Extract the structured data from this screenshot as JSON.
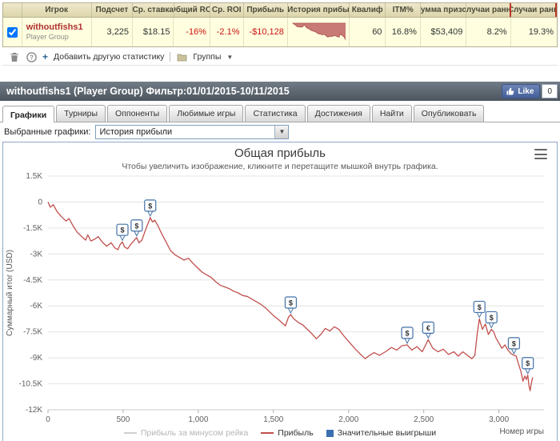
{
  "table": {
    "headers": [
      "Игрок",
      "Подсчет",
      "Ср. ставка",
      "Общий ROI",
      "Ср. ROI",
      "Прибыль",
      "История прибы",
      "Квалиф",
      "ITM%",
      "Сумма призов",
      "Случаи ранне",
      "Случаи ранн"
    ],
    "row": {
      "player": "withoutfishs1",
      "player_sub": "Player Group",
      "count": "3,225",
      "avg_stake": "$18.15",
      "total_roi": "-16%",
      "avg_roi": "-2.1%",
      "profit": "-$10,128",
      "qualif": "60",
      "itm": "16.8%",
      "prizes": "$53,409",
      "early1": "8.2%",
      "early2": "19.3%"
    }
  },
  "toolbar": {
    "add_stat": "Добавить другую статистику",
    "groups": "Группы"
  },
  "header_bar": {
    "title": "withoutfishs1 (Player Group) Фильтр:01/01/2015-10/11/2015",
    "fb_like": "Like",
    "fb_count": "0"
  },
  "tabs": [
    {
      "label": "Графики"
    },
    {
      "label": "Турниры"
    },
    {
      "label": "Оппоненты"
    },
    {
      "label": "Любимые игры"
    },
    {
      "label": "Статистика"
    },
    {
      "label": "Достижения"
    },
    {
      "label": "Найти"
    },
    {
      "label": "Опубликовать"
    }
  ],
  "graph_select": {
    "label": "Выбранные графики:",
    "value": "История прибыли"
  },
  "chart_data": {
    "type": "line",
    "title": "Общая прибыль",
    "subtitle": "Чтобы увеличить изображение, кликните и перетащите мышкой внутрь графика.",
    "xlabel": "Номер игры",
    "ylabel": "Суммарный итог (USD)",
    "xlim": [
      0,
      3300
    ],
    "ylim": [
      -12000,
      1500
    ],
    "yticks": [
      1500,
      0,
      -1500,
      -3000,
      -4500,
      -6000,
      -7500,
      -9000,
      -10500,
      -12000
    ],
    "ytick_labels": [
      "1.5K",
      "0",
      "-1.5K",
      "-3K",
      "-4.5K",
      "-6K",
      "-7.5K",
      "-9K",
      "-10.5K",
      "-12K"
    ],
    "xticks": [
      0,
      500,
      1000,
      1500,
      2000,
      2500,
      3000
    ],
    "xtick_labels": [
      "0",
      "500",
      "1,000",
      "1,500",
      "2,000",
      "2,500",
      "3,000"
    ],
    "grid": true,
    "legend_position": "bottom",
    "series": [
      {
        "name": "Прибыль",
        "color": "#c0504d",
        "points": [
          [
            0,
            0
          ],
          [
            15,
            -300
          ],
          [
            35,
            -150
          ],
          [
            60,
            -550
          ],
          [
            90,
            -850
          ],
          [
            120,
            -1100
          ],
          [
            140,
            -950
          ],
          [
            165,
            -1350
          ],
          [
            195,
            -1750
          ],
          [
            225,
            -2000
          ],
          [
            250,
            -2200
          ],
          [
            265,
            -1900
          ],
          [
            285,
            -2250
          ],
          [
            310,
            -2150
          ],
          [
            335,
            -2000
          ],
          [
            360,
            -2300
          ],
          [
            390,
            -2550
          ],
          [
            420,
            -2350
          ],
          [
            445,
            -2650
          ],
          [
            465,
            -2750
          ],
          [
            480,
            -2450
          ],
          [
            495,
            -2300
          ],
          [
            510,
            -2600
          ],
          [
            530,
            -2700
          ],
          [
            550,
            -2450
          ],
          [
            570,
            -2250
          ],
          [
            590,
            -2050
          ],
          [
            605,
            -2350
          ],
          [
            625,
            -2200
          ],
          [
            645,
            -1700
          ],
          [
            665,
            -1250
          ],
          [
            680,
            -900
          ],
          [
            695,
            -1150
          ],
          [
            710,
            -1050
          ],
          [
            730,
            -1350
          ],
          [
            755,
            -1800
          ],
          [
            785,
            -2300
          ],
          [
            815,
            -2800
          ],
          [
            845,
            -3050
          ],
          [
            875,
            -3200
          ],
          [
            905,
            -3350
          ],
          [
            935,
            -3250
          ],
          [
            965,
            -3550
          ],
          [
            995,
            -3800
          ],
          [
            1025,
            -4050
          ],
          [
            1055,
            -4200
          ],
          [
            1085,
            -4350
          ],
          [
            1115,
            -4600
          ],
          [
            1145,
            -4800
          ],
          [
            1175,
            -4900
          ],
          [
            1205,
            -5000
          ],
          [
            1235,
            -5150
          ],
          [
            1265,
            -5250
          ],
          [
            1295,
            -5400
          ],
          [
            1325,
            -5450
          ],
          [
            1355,
            -5600
          ],
          [
            1385,
            -5750
          ],
          [
            1415,
            -5900
          ],
          [
            1445,
            -6100
          ],
          [
            1475,
            -6350
          ],
          [
            1505,
            -6600
          ],
          [
            1535,
            -6800
          ],
          [
            1560,
            -7000
          ],
          [
            1580,
            -7150
          ],
          [
            1600,
            -6650
          ],
          [
            1615,
            -6500
          ],
          [
            1635,
            -6750
          ],
          [
            1665,
            -6950
          ],
          [
            1695,
            -7100
          ],
          [
            1725,
            -7350
          ],
          [
            1755,
            -7600
          ],
          [
            1785,
            -7900
          ],
          [
            1815,
            -7650
          ],
          [
            1845,
            -7300
          ],
          [
            1875,
            -7450
          ],
          [
            1905,
            -7200
          ],
          [
            1935,
            -7350
          ],
          [
            1965,
            -7700
          ],
          [
            2000,
            -8050
          ],
          [
            2040,
            -8450
          ],
          [
            2080,
            -8800
          ],
          [
            2110,
            -9050
          ],
          [
            2140,
            -8850
          ],
          [
            2170,
            -8700
          ],
          [
            2205,
            -8850
          ],
          [
            2245,
            -8650
          ],
          [
            2285,
            -8400
          ],
          [
            2320,
            -8550
          ],
          [
            2355,
            -8300
          ],
          [
            2390,
            -8250
          ],
          [
            2420,
            -8550
          ],
          [
            2455,
            -8350
          ],
          [
            2490,
            -8650
          ],
          [
            2530,
            -7950
          ],
          [
            2560,
            -8450
          ],
          [
            2595,
            -8650
          ],
          [
            2630,
            -8500
          ],
          [
            2665,
            -8800
          ],
          [
            2700,
            -8650
          ],
          [
            2730,
            -8900
          ],
          [
            2760,
            -8650
          ],
          [
            2790,
            -8850
          ],
          [
            2820,
            -9050
          ],
          [
            2840,
            -8850
          ],
          [
            2855,
            -7650
          ],
          [
            2870,
            -6750
          ],
          [
            2890,
            -7350
          ],
          [
            2910,
            -7050
          ],
          [
            2930,
            -7650
          ],
          [
            2950,
            -7350
          ],
          [
            2965,
            -7500
          ],
          [
            2980,
            -7850
          ],
          [
            3000,
            -8150
          ],
          [
            3020,
            -8450
          ],
          [
            3040,
            -8250
          ],
          [
            3060,
            -8550
          ],
          [
            3080,
            -8750
          ],
          [
            3100,
            -8850
          ],
          [
            3115,
            -8900
          ],
          [
            3130,
            -9350
          ],
          [
            3145,
            -9750
          ],
          [
            3160,
            -10350
          ],
          [
            3172,
            -10050
          ],
          [
            3182,
            -10250
          ],
          [
            3192,
            -10000
          ],
          [
            3200,
            -10600
          ],
          [
            3208,
            -10900
          ],
          [
            3216,
            -10450
          ],
          [
            3225,
            -10128
          ]
        ]
      }
    ],
    "markers": [
      {
        "x": 495,
        "y": -2300,
        "label": "$"
      },
      {
        "x": 590,
        "y": -2050,
        "label": "$"
      },
      {
        "x": 680,
        "y": -900,
        "label": "$"
      },
      {
        "x": 1615,
        "y": -6500,
        "label": "$"
      },
      {
        "x": 2390,
        "y": -8250,
        "label": "$"
      },
      {
        "x": 2530,
        "y": -7950,
        "label": "€"
      },
      {
        "x": 2870,
        "y": -6750,
        "label": "$"
      },
      {
        "x": 2950,
        "y": -7350,
        "label": "$"
      },
      {
        "x": 3100,
        "y": -8850,
        "label": "$"
      },
      {
        "x": 3192,
        "y": -10000,
        "label": "$"
      }
    ],
    "legend": [
      {
        "label": "Прибыль за минусом рейка",
        "type": "line",
        "color": "#bdbdbd",
        "disabled": true
      },
      {
        "label": "Прибыль",
        "type": "line",
        "color": "#c0504d",
        "disabled": false
      },
      {
        "label": "Значительные выигрыши",
        "type": "square",
        "color": "#3a6fb0",
        "disabled": false
      }
    ],
    "colors": {
      "line": "#c0504d",
      "marker_border": "#4572a7",
      "grid": "#e4e4e4"
    }
  }
}
